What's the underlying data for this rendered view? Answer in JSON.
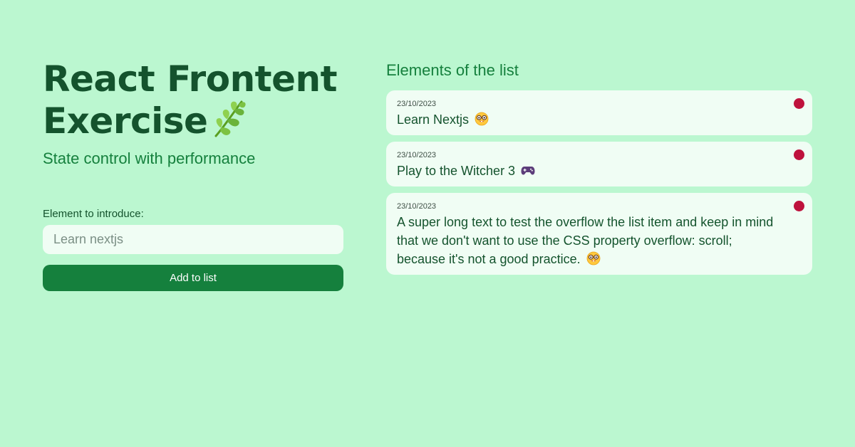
{
  "header": {
    "title_line1": "React Frontent",
    "title_line2": "Exercise",
    "title_icon": "herb-leaf-icon",
    "subtitle": "State control with performance"
  },
  "form": {
    "label": "Element to introduce:",
    "placeholder": "Learn nextjs",
    "value": "",
    "button_label": "Add to list"
  },
  "list": {
    "title": "Elements of the list",
    "items": [
      {
        "date": "23/10/2023",
        "text": "Learn Nextjs",
        "emoji": "nerd-face-icon"
      },
      {
        "date": "23/10/2023",
        "text": "Play to the Witcher 3",
        "emoji": "game-controller-icon"
      },
      {
        "date": "23/10/2023",
        "text": "A super long text to test the overflow the list item and keep in mind that we don't want to use the CSS property overflow: scroll; because it's not a good practice.",
        "emoji": "nerd-face-icon"
      }
    ]
  },
  "colors": {
    "background": "#bbf7d0",
    "title": "#14532d",
    "accent": "#15803d",
    "card": "#f0fdf4",
    "delete_dot": "#be123c"
  }
}
